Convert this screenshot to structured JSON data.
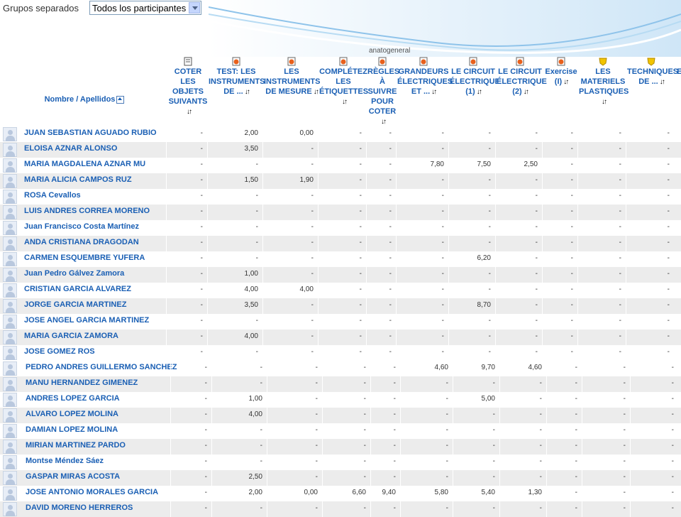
{
  "groups": {
    "label": "Grupos separados",
    "selected": "Todos los participantes"
  },
  "header": {
    "name_label": "Nombre / Apellidos",
    "category_label": "anatogeneral",
    "columns": [
      {
        "label": "COTER LES OBJETS SUIVANTS",
        "icon": "document-icon"
      },
      {
        "label": "TEST: LES INSTRUMENTS DE ...",
        "icon": "quiz-icon"
      },
      {
        "label": "LES INSTRUMENTS DE MESURE",
        "icon": "quiz-icon"
      },
      {
        "label": "COMPLÉTEZ LES ÉTIQUETTES",
        "icon": "quiz-icon"
      },
      {
        "label": "RÈGLES À SUIVRE POUR COTER",
        "icon": "quiz-icon"
      },
      {
        "label": "GRANDEURS ÉLECTRIQUES ET ...",
        "icon": "quiz-icon"
      },
      {
        "label": "LE CIRCUIT ÉLECTRIQUE (1)",
        "icon": "quiz-icon"
      },
      {
        "label": "LE CIRCUIT ÉLECTRIQUE (2)",
        "icon": "quiz-icon"
      },
      {
        "label": "Exercise (I)",
        "icon": "quiz-icon"
      },
      {
        "label": "LES MATERIELS PLASTIQUES",
        "icon": "lesson-icon"
      },
      {
        "label": "TECHNIQUES DE ...",
        "icon": "lesson-icon"
      },
      {
        "label": "E... d...",
        "icon": "quiz-icon"
      }
    ]
  },
  "rows": [
    {
      "name": "JUAN SEBASTIAN AGUADO RUBIO",
      "v": [
        "-",
        "2,00",
        "0,00",
        "-",
        "-",
        "-",
        "-",
        "-",
        "-",
        "-",
        "-"
      ]
    },
    {
      "name": "ELOISA AZNAR ALONSO",
      "v": [
        "-",
        "3,50",
        "-",
        "-",
        "-",
        "-",
        "-",
        "-",
        "-",
        "-",
        "-"
      ]
    },
    {
      "name": "MARIA MAGDALENA AZNAR MU",
      "v": [
        "-",
        "-",
        "-",
        "-",
        "-",
        "7,80",
        "7,50",
        "2,50",
        "-",
        "-",
        "-"
      ]
    },
    {
      "name": "MARIA ALICIA CAMPOS RUZ",
      "v": [
        "-",
        "1,50",
        "1,90",
        "-",
        "-",
        "-",
        "-",
        "-",
        "-",
        "-",
        "-"
      ]
    },
    {
      "name": "ROSA Cevallos",
      "v": [
        "-",
        "-",
        "-",
        "-",
        "-",
        "-",
        "-",
        "-",
        "-",
        "-",
        "-"
      ]
    },
    {
      "name": "LUIS ANDRES CORREA MORENO",
      "v": [
        "-",
        "-",
        "-",
        "-",
        "-",
        "-",
        "-",
        "-",
        "-",
        "-",
        "-"
      ]
    },
    {
      "name": "Juan Francisco Costa Martínez",
      "v": [
        "-",
        "-",
        "-",
        "-",
        "-",
        "-",
        "-",
        "-",
        "-",
        "-",
        "-"
      ]
    },
    {
      "name": "ANDA CRISTIANA DRAGODAN",
      "v": [
        "-",
        "-",
        "-",
        "-",
        "-",
        "-",
        "-",
        "-",
        "-",
        "-",
        "-"
      ]
    },
    {
      "name": "CARMEN ESQUEMBRE YUFERA",
      "v": [
        "-",
        "-",
        "-",
        "-",
        "-",
        "-",
        "6,20",
        "-",
        "-",
        "-",
        "-"
      ]
    },
    {
      "name": "Juan Pedro Gálvez Zamora",
      "v": [
        "-",
        "1,00",
        "-",
        "-",
        "-",
        "-",
        "-",
        "-",
        "-",
        "-",
        "-"
      ]
    },
    {
      "name": "CRISTIAN GARCIA ALVAREZ",
      "v": [
        "-",
        "4,00",
        "4,00",
        "-",
        "-",
        "-",
        "-",
        "-",
        "-",
        "-",
        "-"
      ]
    },
    {
      "name": "JORGE GARCIA MARTINEZ",
      "v": [
        "-",
        "3,50",
        "-",
        "-",
        "-",
        "-",
        "8,70",
        "-",
        "-",
        "-",
        "-"
      ]
    },
    {
      "name": "JOSE ANGEL GARCIA MARTINEZ",
      "v": [
        "-",
        "-",
        "-",
        "-",
        "-",
        "-",
        "-",
        "-",
        "-",
        "-",
        "-"
      ]
    },
    {
      "name": "MARIA GARCIA ZAMORA",
      "v": [
        "-",
        "4,00",
        "-",
        "-",
        "-",
        "-",
        "-",
        "-",
        "-",
        "-",
        "-"
      ]
    },
    {
      "name": "JOSE GOMEZ ROS",
      "v": [
        "-",
        "-",
        "-",
        "-",
        "-",
        "-",
        "-",
        "-",
        "-",
        "-",
        "-"
      ]
    }
  ],
  "rows2": [
    {
      "name": "PEDRO ANDRES GUILLERMO SANCHEZ",
      "v": [
        "-",
        "-",
        "-",
        "-",
        "-",
        "4,60",
        "9,70",
        "4,60",
        "-",
        "-",
        "-"
      ]
    },
    {
      "name": "MANU HERNANDEZ GIMENEZ",
      "v": [
        "-",
        "-",
        "-",
        "-",
        "-",
        "-",
        "-",
        "-",
        "-",
        "-",
        "-"
      ]
    },
    {
      "name": "ANDRES LOPEZ GARCIA",
      "v": [
        "-",
        "1,00",
        "-",
        "-",
        "-",
        "-",
        "5,00",
        "-",
        "-",
        "-",
        "-"
      ]
    },
    {
      "name": "ALVARO LOPEZ MOLINA",
      "v": [
        "-",
        "4,00",
        "-",
        "-",
        "-",
        "-",
        "-",
        "-",
        "-",
        "-",
        "-"
      ]
    },
    {
      "name": "DAMIAN LOPEZ MOLINA",
      "v": [
        "-",
        "-",
        "-",
        "-",
        "-",
        "-",
        "-",
        "-",
        "-",
        "-",
        "-"
      ]
    },
    {
      "name": "MIRIAN MARTINEZ PARDO",
      "v": [
        "-",
        "-",
        "-",
        "-",
        "-",
        "-",
        "-",
        "-",
        "-",
        "-",
        "-"
      ]
    },
    {
      "name": "Montse Méndez Sáez",
      "v": [
        "-",
        "-",
        "-",
        "-",
        "-",
        "-",
        "-",
        "-",
        "-",
        "-",
        "-"
      ]
    },
    {
      "name": "GASPAR MIRAS ACOSTA",
      "v": [
        "-",
        "2,50",
        "-",
        "-",
        "-",
        "-",
        "-",
        "-",
        "-",
        "-",
        "-"
      ]
    },
    {
      "name": "JOSE ANTONIO MORALES GARCIA",
      "v": [
        "-",
        "2,00",
        "0,00",
        "6,60",
        "9,40",
        "5,80",
        "5,40",
        "1,30",
        "-",
        "-",
        "-"
      ]
    },
    {
      "name": "DAVID MORENO HERREROS",
      "v": [
        "-",
        "-",
        "-",
        "-",
        "-",
        "-",
        "-",
        "-",
        "-",
        "-",
        "-"
      ]
    }
  ]
}
